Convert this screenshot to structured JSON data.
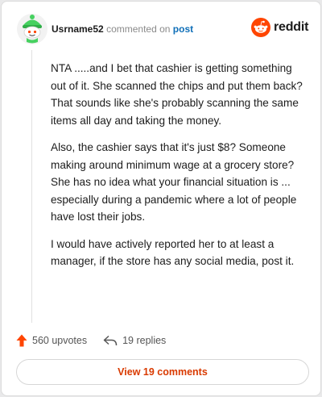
{
  "header": {
    "username": "Usrname52",
    "commented_on_text": "commented on",
    "post_link": "post",
    "logo_text": "reddit"
  },
  "comment": {
    "paragraphs": [
      "NTA .....and I bet that cashier is getting something out of it. She scanned the chips and put them back? That sounds like she's probably scanning the same items all day and taking the money.",
      "Also, the cashier says that it's just $8? Someone making around minimum wage at a grocery store? She has no idea what your financial situation is ... especially during a pandemic where a lot of people have lost their jobs.",
      "I would have actively reported her to at least a manager, if the store has any social media, post it."
    ]
  },
  "actions": {
    "upvotes": "560 upvotes",
    "replies": "19 replies"
  },
  "view_button": "View 19 comments",
  "colors": {
    "accent": "#d93a00",
    "reddit_orange": "#ff4500",
    "link_blue": "#0f6fb8",
    "avatar_green": "#46d160"
  },
  "icons": [
    "avatar",
    "reddit-logo-icon",
    "upvote-arrow-icon",
    "reply-arrow-icon"
  ]
}
